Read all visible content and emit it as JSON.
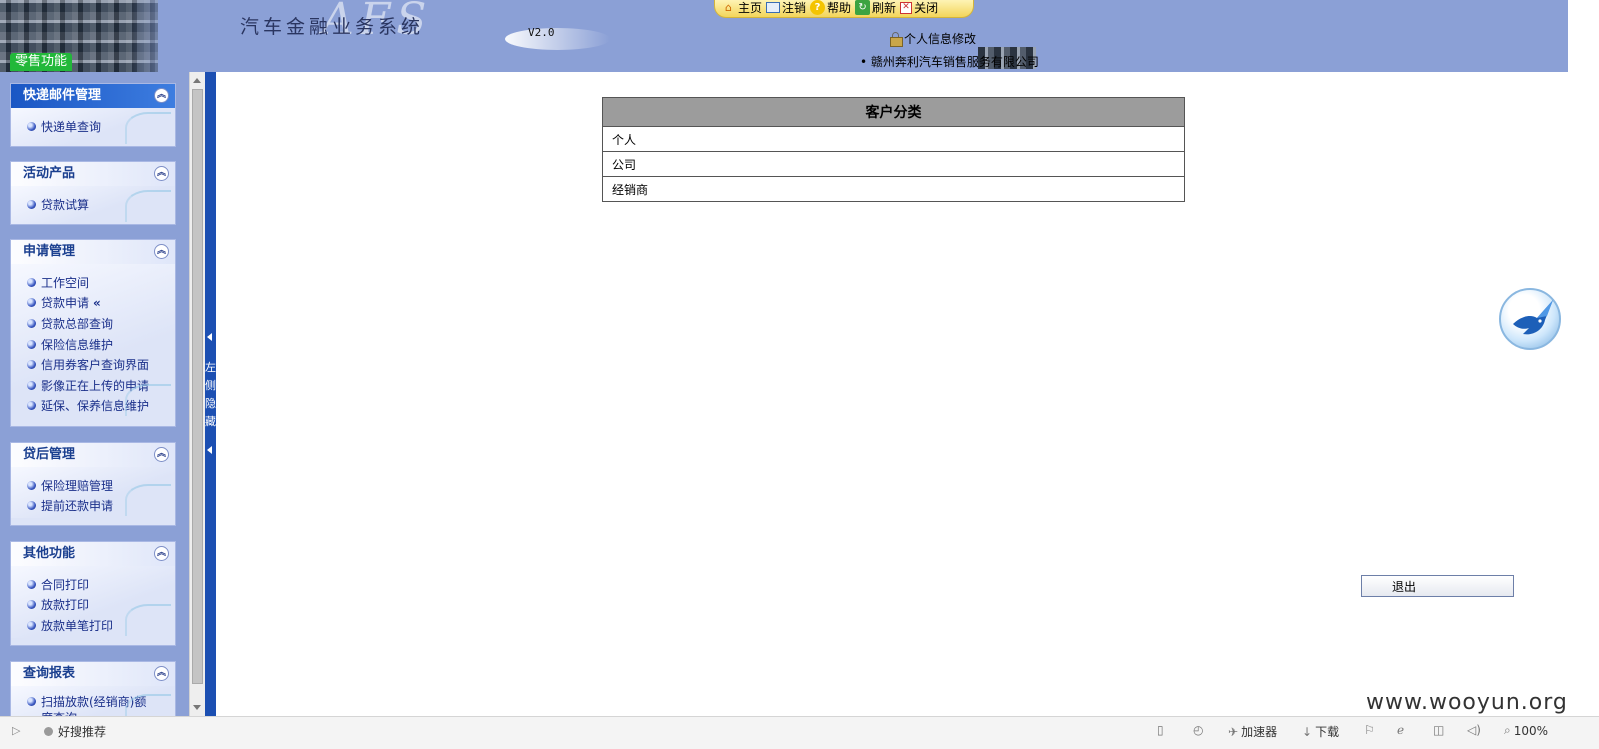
{
  "header": {
    "system_title": "汽车金融业务系统",
    "logo_mark": "AFS",
    "version": "V2.0",
    "retail_badge": "零售功能",
    "profile_link": "个人信息修改",
    "company": "• 赣州奔利汽车销售服务有限公司",
    "toolbar": [
      {
        "label": "主页",
        "icon": "home-icon"
      },
      {
        "label": "注销",
        "icon": "logout-icon"
      },
      {
        "label": "帮助",
        "icon": "help-icon"
      },
      {
        "label": "刷新",
        "icon": "refresh-icon"
      },
      {
        "label": "关闭",
        "icon": "close-icon"
      }
    ]
  },
  "sidebar": {
    "panels": [
      {
        "title": "快递邮件管理",
        "active": true,
        "items": [
          "快递单查询"
        ]
      },
      {
        "title": "活动产品",
        "items": [
          "贷款试算"
        ]
      },
      {
        "title": "申请管理",
        "items": [
          "工作空间",
          "贷款申请",
          "贷款总部查询",
          "保险信息维护",
          "信用券客户查询界面",
          "影像正在上传的申请",
          "延保、保养信息维护"
        ],
        "current_index": 1,
        "current_marker": "«"
      },
      {
        "title": "贷后管理",
        "items": [
          "保险理赔管理",
          "提前还款申请"
        ]
      },
      {
        "title": "其他功能",
        "items": [
          "合同打印",
          "放款打印",
          "放款单笔打印"
        ]
      },
      {
        "title": "查询报表",
        "items": [
          "扫描放款(经销商)额度查询"
        ]
      }
    ],
    "hide_toggle_label": "左侧隐藏"
  },
  "main": {
    "table_header": "客户分类",
    "rows": [
      "个人",
      "公司",
      "经销商"
    ],
    "exit_button": "退出"
  },
  "statusbar": {
    "recommend": "好搜推荐",
    "accelerator": "加速器",
    "download": "下载",
    "zoom": "100%"
  },
  "watermark": "www.wooyun.org"
}
